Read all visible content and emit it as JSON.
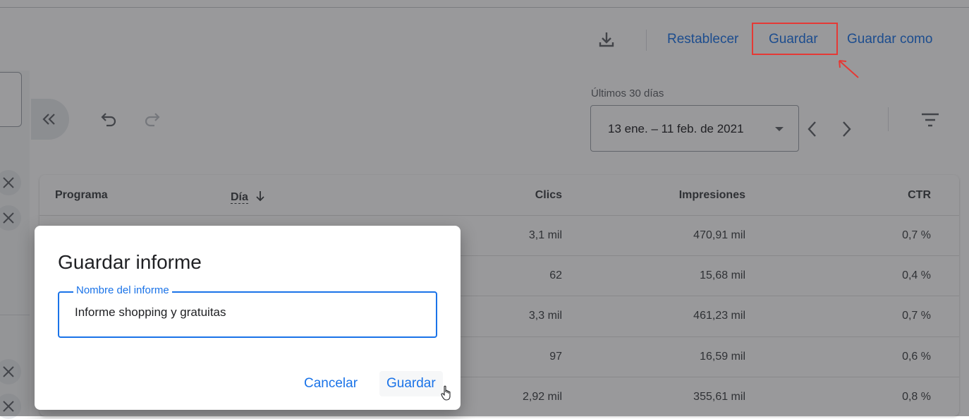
{
  "toolbar": {
    "download_icon": "download-icon",
    "reset_label": "Restablecer",
    "save_label": "Guardar",
    "save_as_label": "Guardar como"
  },
  "filters": {
    "date_range_label": "Últimos 30 días",
    "date_range_value": "13 ene. – 11 feb. de 2021"
  },
  "table": {
    "columns": [
      "Programa",
      "Día",
      "Clics",
      "Impresiones",
      "CTR"
    ],
    "rows": [
      {
        "clics": "3,1 mil",
        "impresiones": "470,91 mil",
        "ctr": "0,7 %"
      },
      {
        "clics": "62",
        "impresiones": "15,68 mil",
        "ctr": "0,4 %"
      },
      {
        "clics": "3,3 mil",
        "impresiones": "461,23 mil",
        "ctr": "0,7 %"
      },
      {
        "clics": "97",
        "impresiones": "16,59 mil",
        "ctr": "0,6 %"
      },
      {
        "clics": "2,92 mil",
        "impresiones": "355,61 mil",
        "ctr": "0,8 %"
      }
    ]
  },
  "dialog": {
    "title": "Guardar informe",
    "field_label": "Nombre del informe",
    "field_value": "Informe shopping y gratuitas",
    "cancel_label": "Cancelar",
    "save_label": "Guardar"
  },
  "colors": {
    "accent": "#1a73e8",
    "annotation": "#e53935"
  }
}
